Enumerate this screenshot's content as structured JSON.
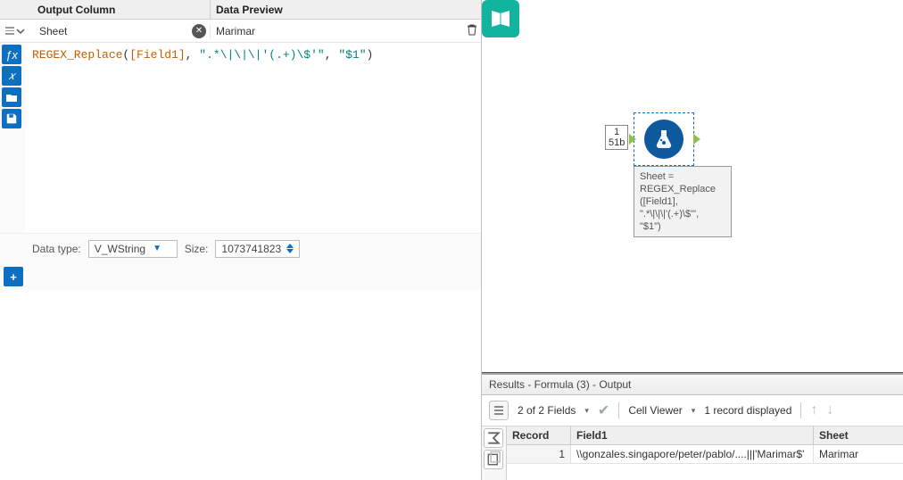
{
  "headers": {
    "output": "Output Column",
    "preview": "Data Preview"
  },
  "output_column": {
    "value": "Sheet"
  },
  "preview_value": "Marimar",
  "expression": {
    "fn": "REGEX_Replace",
    "open": "(",
    "field": "[Field1]",
    "comma1": ", ",
    "str1": "\".*\\|\\|\\|'(.+)\\$'\"",
    "comma2": ", ",
    "str2": "\"$1\"",
    "close": ")"
  },
  "datatype": {
    "label": "Data type:",
    "value": "V_WString",
    "size_label": "Size:",
    "size_value": "1073741823"
  },
  "canvas": {
    "meta_lines": [
      "1",
      "51b"
    ],
    "tooltip_lines": [
      "Sheet =",
      "REGEX_Replace",
      "([Field1],",
      "\".*\\|\\|\\|'(.+)\\$'\",",
      "\"$1\")"
    ]
  },
  "results": {
    "title": "Results - Formula (3) - Output",
    "fields_text": "2 of 2 Fields",
    "cell_viewer": "Cell Viewer",
    "records_text": "1 record displayed",
    "columns": {
      "record": "Record",
      "field1": "Field1",
      "sheet": "Sheet"
    },
    "rows": [
      {
        "record": "1",
        "field1": "\\\\gonzales.singapore/peter/pablo/....|||'Marimar$'",
        "sheet": "Marimar"
      }
    ]
  }
}
